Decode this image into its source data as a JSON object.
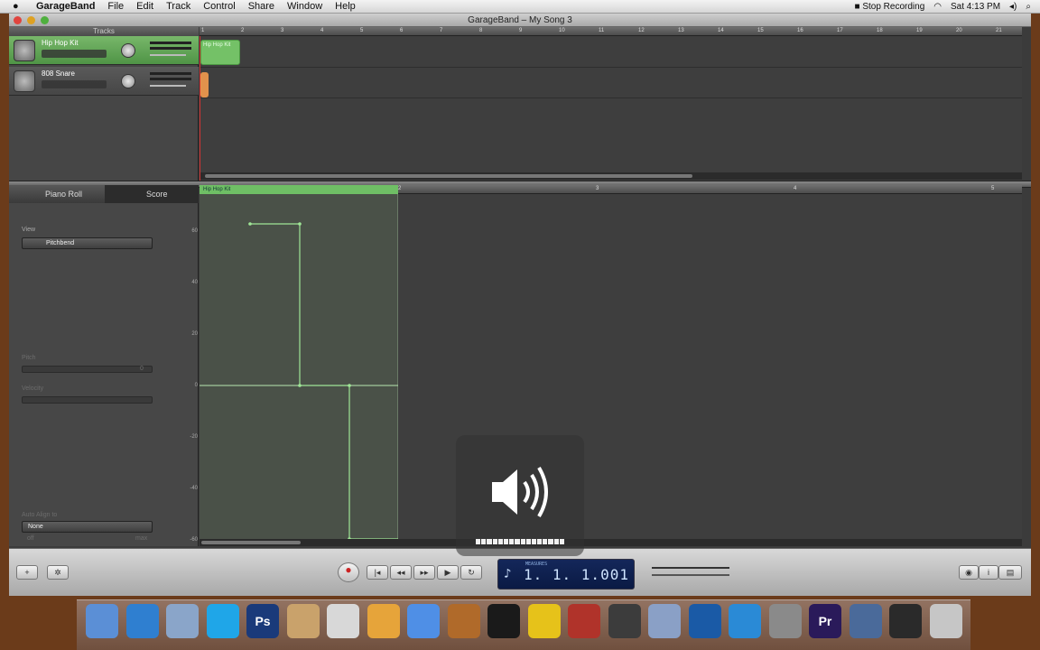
{
  "menubar": {
    "app": "GarageBand",
    "menus": [
      "File",
      "Edit",
      "Track",
      "Control",
      "Share",
      "Window",
      "Help"
    ],
    "status_recording": "Stop Recording",
    "clock": "Sat 4:13 PM"
  },
  "window": {
    "title": "GarageBand – My Song 3"
  },
  "tracks": {
    "header": "Tracks",
    "items": [
      {
        "name": "Hip Hop Kit"
      },
      {
        "name": "808 Snare"
      }
    ],
    "region_label": "Hip Hop Kit"
  },
  "ruler_top": {
    "ticks": [
      "1",
      "2",
      "3",
      "4",
      "5",
      "6",
      "7",
      "8",
      "9",
      "10",
      "11",
      "12",
      "13",
      "14",
      "15",
      "16",
      "17",
      "18",
      "19",
      "20",
      "21"
    ]
  },
  "editor": {
    "tabs": {
      "piano": "Piano Roll",
      "score": "Score"
    },
    "view_label": "View",
    "view_value": "Pitchbend",
    "pitch_label": "Pitch",
    "pitch_value": "0",
    "velocity_label": "Velocity",
    "auto_align_label": "Auto Align to",
    "auto_align_value": "None",
    "off_label": "off",
    "max_label": "max",
    "region_label": "Hip Hop Kit",
    "ruler_ticks": [
      "2",
      "3",
      "4",
      "5"
    ],
    "y_labels": [
      "60",
      "40",
      "20",
      "0",
      "-20",
      "-40",
      "-60"
    ]
  },
  "lcd": {
    "label": "MEASURES",
    "value": "1. 1. 1.001",
    "sub1": "bar",
    "sub2": "beat"
  },
  "colors": {
    "track_selected": "#5fa654",
    "playhead": "#d23232",
    "region_green": "#74c167",
    "lcd_bg": "#0f2150"
  },
  "dock": {
    "icons": [
      "finder-icon",
      "safari-icon",
      "preview-icon",
      "skype-icon",
      "photoshop-icon",
      "photo-icon",
      "scanner-icon",
      "iphoto-icon",
      "itunes-icon",
      "garageband-icon",
      "audition-icon",
      "radiation-icon",
      "toolbox-icon",
      "quicktime-icon",
      "script-icon",
      "terminal-icon",
      "wifi-icon",
      "imovie-icon",
      "premiere-icon",
      "brush-icon",
      "folder-icon",
      "trash-icon"
    ],
    "ps_label": "Ps",
    "pr_label": "Pr"
  }
}
